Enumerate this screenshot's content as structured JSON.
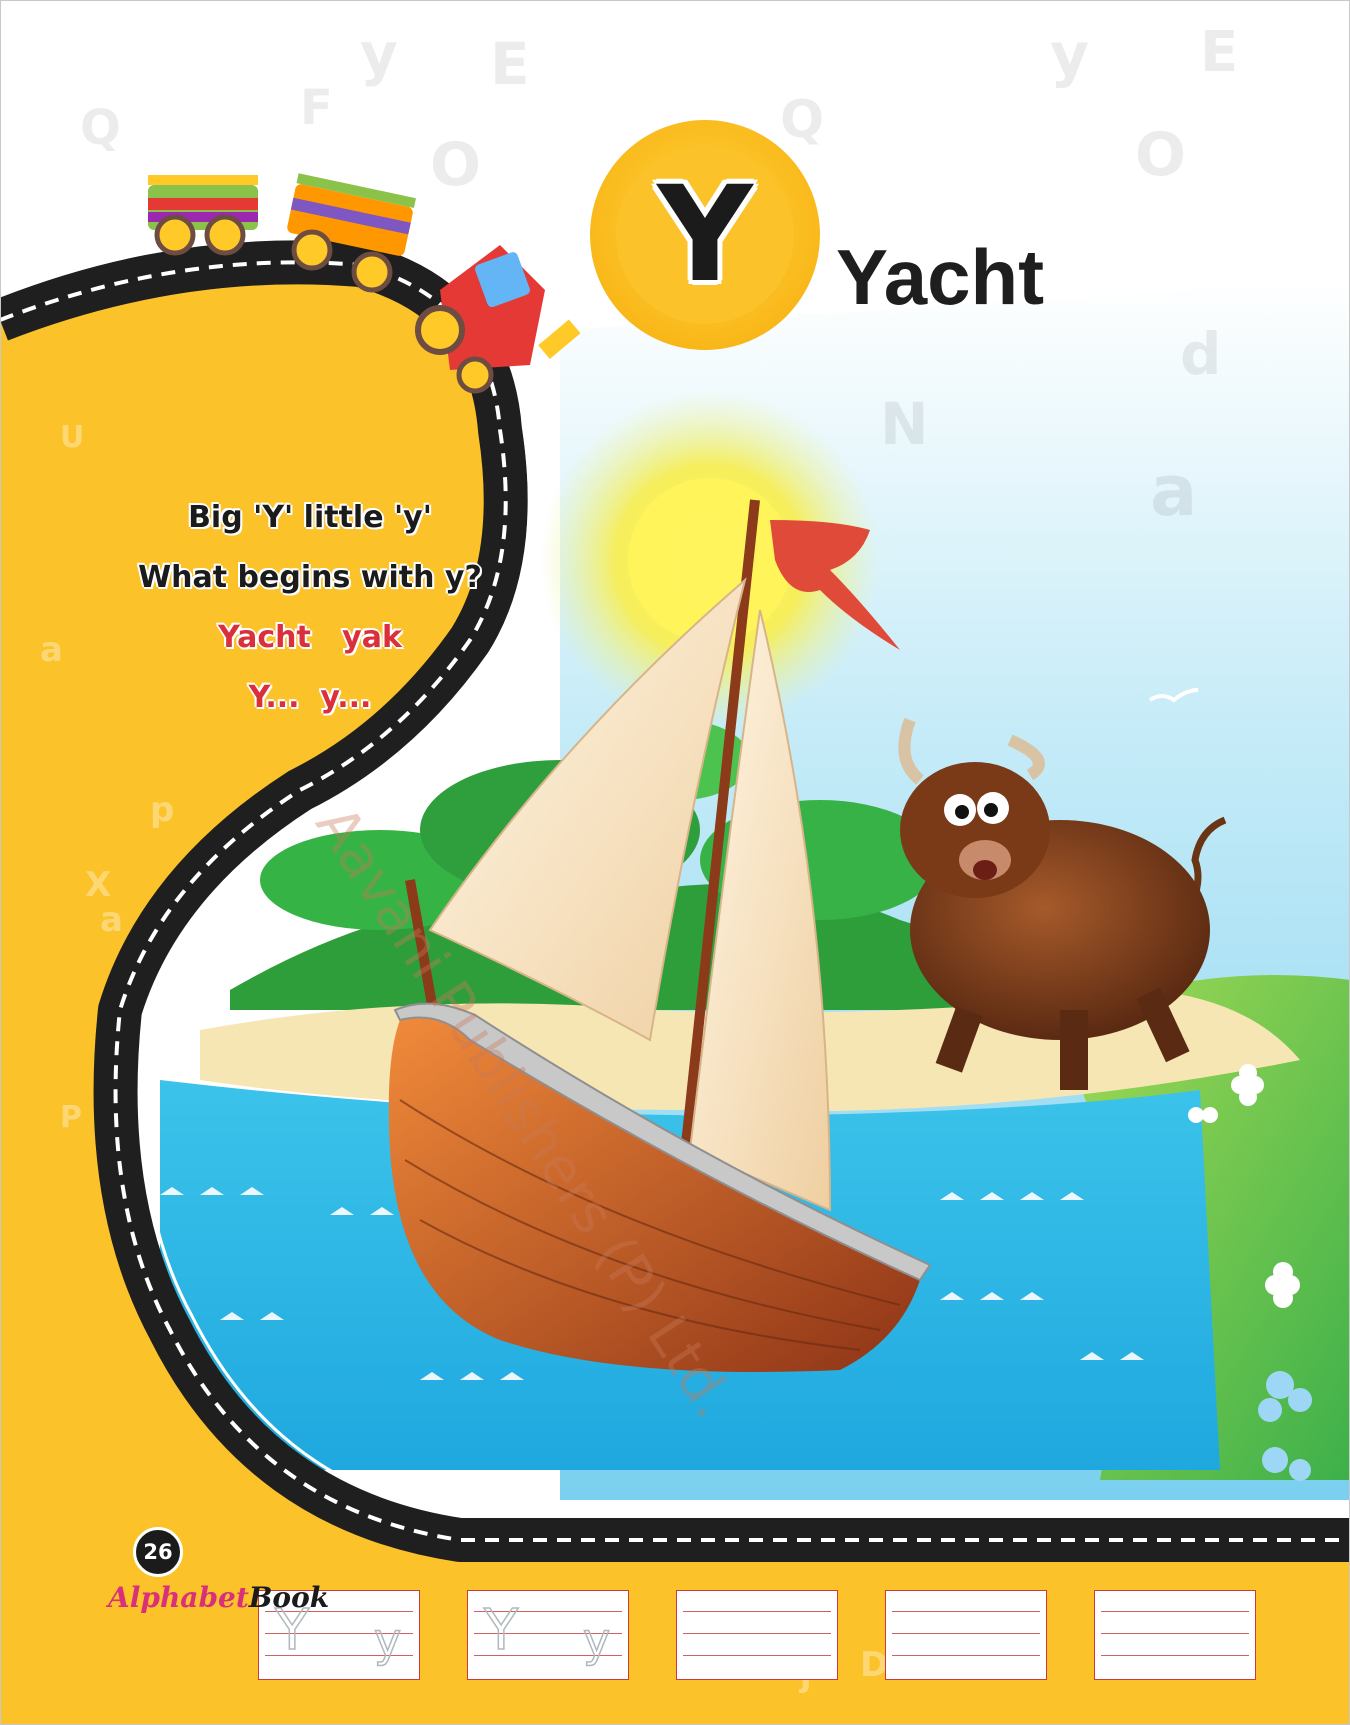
{
  "page": {
    "letter": "Y",
    "word": "Yacht",
    "page_number": "26",
    "brand_part1": "Alphabet",
    "brand_part2": "Book",
    "watermark": "Aavani Publishers (P) Ltd."
  },
  "rhyme": {
    "line1": "Big 'Y' little 'y'",
    "line2": "What begins with y?",
    "line3": "Yacht   yak",
    "line4": "Y...  y..."
  },
  "tracing": {
    "boxes": [
      {
        "big": "Y",
        "small": "y"
      },
      {
        "big": "Y",
        "small": "y"
      },
      {
        "big": "",
        "small": ""
      },
      {
        "big": "",
        "small": ""
      },
      {
        "big": "",
        "small": ""
      }
    ]
  },
  "colors": {
    "yellow": "#fcc22a",
    "road": "#222222",
    "sky": "#8fd8f0",
    "sea": "#29b6e6",
    "sand": "#f6e6b4",
    "title_red": "#d9303c"
  },
  "icons": [
    "toy-train-icon",
    "yacht-illustration",
    "yak-illustration",
    "sun-icon",
    "palm-tree-icon",
    "flower-icon",
    "seagull-icon"
  ]
}
